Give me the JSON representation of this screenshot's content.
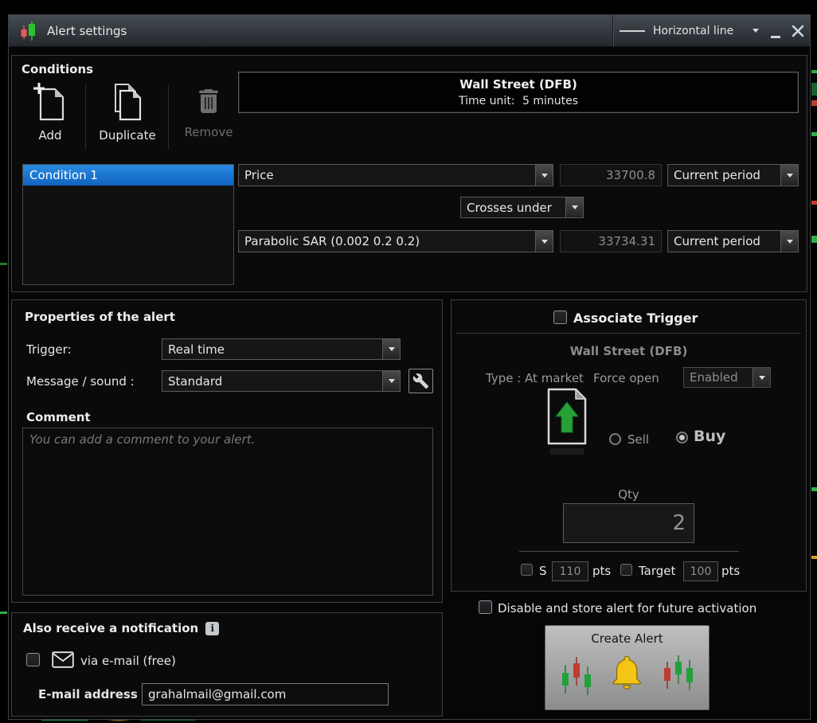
{
  "colors": {
    "titlebar_top": "#454b52",
    "titlebar_bottom": "#24282d",
    "panel_border": "#3e3e3e",
    "selection_blue": "#1373d4",
    "candle_green": "#2fba2f",
    "candle_red": "#e05c5c",
    "buy_arrow_green": "#28a038",
    "bell_gold": "#f4c515",
    "disabled_text": "#8e8e8e",
    "text": "#e8e8e8"
  },
  "titlebar": {
    "title": "Alert settings",
    "tool_label": "Horizontal line"
  },
  "conditions": {
    "header": "Conditions",
    "toolbar": {
      "add": "Add",
      "duplicate": "Duplicate",
      "remove": "Remove"
    },
    "instrument": "Wall Street (DFB)",
    "time_unit_label": "Time unit:",
    "time_unit_value": "5 minutes",
    "list": [
      {
        "label": "Condition 1"
      }
    ],
    "row1": {
      "indicator": "Price",
      "value": "33700.8",
      "period": "Current period"
    },
    "operator": "Crosses under",
    "row2": {
      "indicator": "Parabolic SAR (0.002 0.2 0.2)",
      "value": "33734.31",
      "period": "Current period"
    }
  },
  "properties": {
    "header": "Properties of the alert",
    "trigger_label": "Trigger:",
    "trigger_value": "Real time",
    "message_label": "Message / sound :",
    "message_value": "Standard",
    "comment_label": "Comment",
    "comment_placeholder": "You can add a comment to your alert."
  },
  "trigger": {
    "header": "Associate Trigger",
    "instrument": "Wall Street (DFB)",
    "type_label": "Type : At market",
    "force_open_label": "Force open",
    "force_open_value": "Enabled",
    "sell_label": "Sell",
    "buy_label": "Buy",
    "qty_label": "Qty",
    "qty_value": "2",
    "stop_label": "S",
    "stop_value": "110",
    "stop_unit": "pts",
    "target_label": "Target",
    "target_value": "100",
    "target_unit": "pts"
  },
  "footer": {
    "disable_label": "Disable and store alert for future activation",
    "create_label": "Create Alert"
  },
  "notification": {
    "header": "Also receive a notification",
    "info_icon": "i",
    "email_option": "via e-mail (free)",
    "email_label": "E-mail address",
    "email_value": "grahalmail@gmail.com"
  }
}
